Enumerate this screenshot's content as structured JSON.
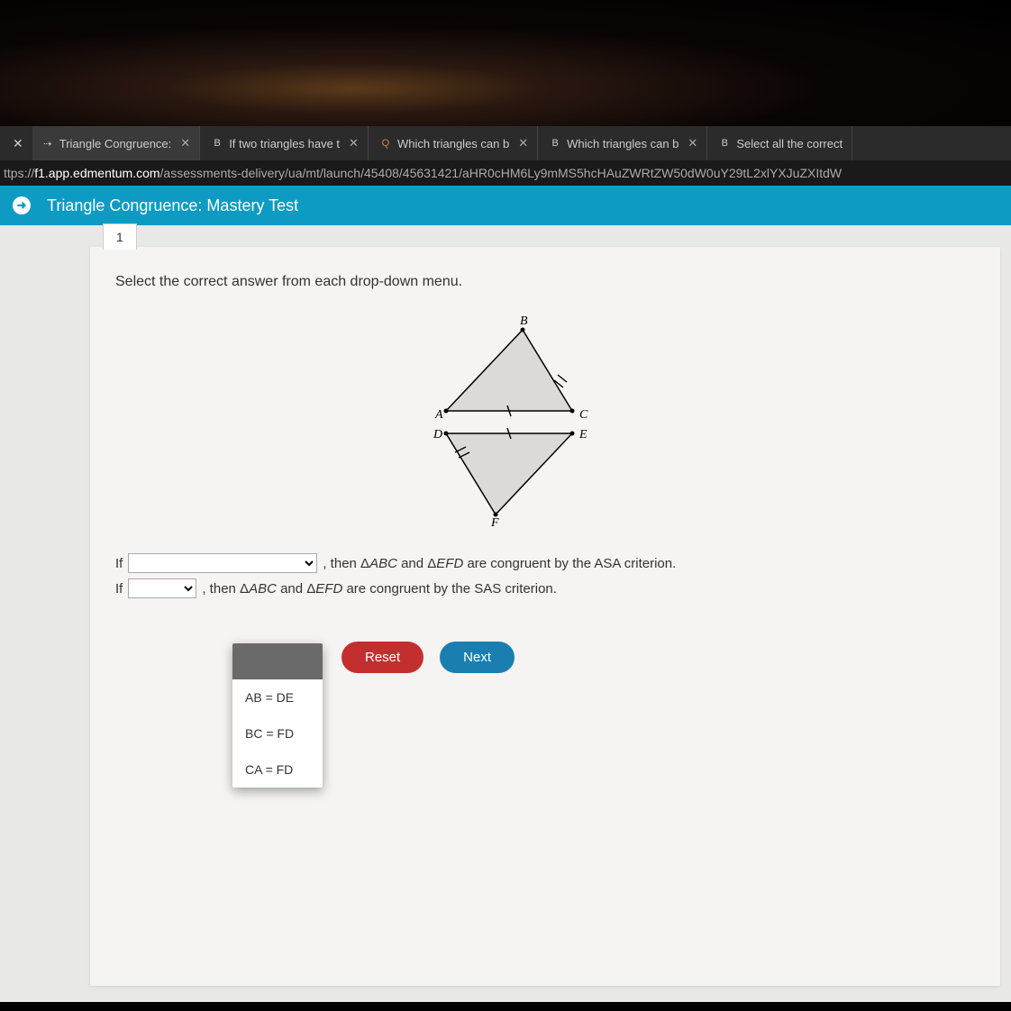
{
  "tabs": [
    {
      "icon": "⇢",
      "label": "Triangle Congruence:"
    },
    {
      "icon": "B",
      "label": "If two triangles have t"
    },
    {
      "icon": "🔍",
      "label": "Which triangles can b"
    },
    {
      "icon": "B",
      "label": "Which triangles can b"
    },
    {
      "icon": "B",
      "label": "Select all the correct"
    }
  ],
  "url_prefix": "ttps://",
  "url_host": "f1.app.edmentum.com",
  "url_path": "/assessments-delivery/ua/mt/launch/45408/45631421/aHR0cHM6Ly9mMS5hcHAuZWRtZW50dW0uY29tL2xlYXJuZXItdW",
  "page_title": "Triangle Congruence: Mastery Test",
  "question_number": "1",
  "prompt": "Select the correct answer from each drop-down menu.",
  "diagram": {
    "top": {
      "A": "A",
      "B": "B",
      "C": "C"
    },
    "bottom": {
      "D": "D",
      "E": "E",
      "F": "F"
    }
  },
  "statements": {
    "if_label": "If",
    "line1_tail": ", then Δ",
    "abc": "ABC",
    "and": " and Δ",
    "efd": "EFD",
    "asa_tail": " are congruent by the ASA criterion.",
    "sas_tail": " are congruent by the SAS criterion."
  },
  "dropdown_options": [
    "",
    "AB = DE",
    "BC = FD",
    "CA = FD"
  ],
  "buttons": {
    "reset": "Reset",
    "next": "Next"
  }
}
